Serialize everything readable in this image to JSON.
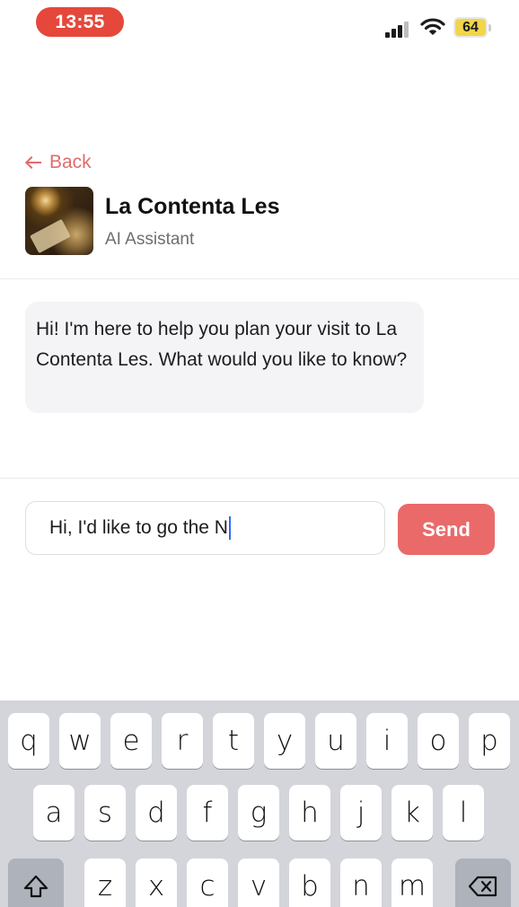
{
  "status_bar": {
    "time": "13:55",
    "battery": "64",
    "icons": [
      "signal-icon",
      "wifi-icon",
      "battery-icon"
    ]
  },
  "header": {
    "back_label": "Back",
    "place_name": "La Contenta Les",
    "subtitle": "AI Assistant"
  },
  "chat": {
    "messages": [
      {
        "role": "assistant",
        "text": "Hi! I'm here to help you plan your visit to La Contenta Les. What would you like to know?"
      }
    ]
  },
  "composer": {
    "input_value": "Hi, I'd like to go the N",
    "send_label": "Send"
  },
  "keyboard": {
    "row1": [
      "q",
      "w",
      "e",
      "r",
      "t",
      "y",
      "u",
      "i",
      "o",
      "p"
    ],
    "row2": [
      "a",
      "s",
      "d",
      "f",
      "g",
      "h",
      "j",
      "k",
      "l"
    ],
    "row3": [
      "z",
      "x",
      "c",
      "v",
      "b",
      "n",
      "m"
    ],
    "shift_icon": "shift-icon",
    "delete_icon": "delete-icon"
  },
  "colors": {
    "accent": "#e26c6c",
    "send_button": "#ea6a6a",
    "time_pill": "#e5473b",
    "battery_fill": "#f2d54a",
    "bubble_bg": "#f4f4f6",
    "keyboard_bg": "#d3d5db"
  }
}
